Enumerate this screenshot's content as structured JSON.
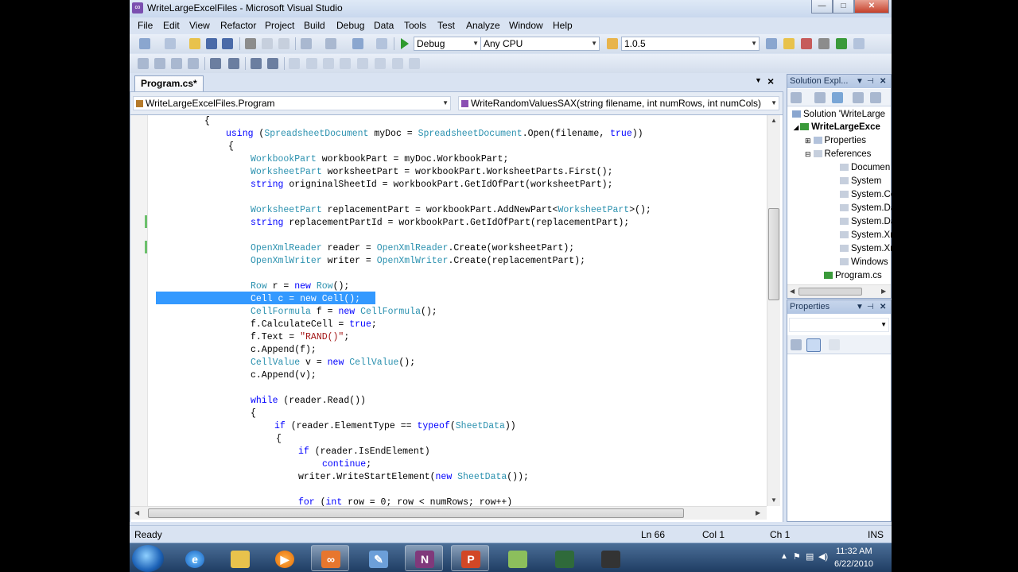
{
  "window": {
    "title": "WriteLargeExcelFiles - Microsoft Visual Studio",
    "min": "0",
    "max": "1",
    "close": "r"
  },
  "menu": [
    "File",
    "Edit",
    "View",
    "Refactor",
    "Project",
    "Build",
    "Debug",
    "Data",
    "Tools",
    "Test",
    "Analyze",
    "Window",
    "Help"
  ],
  "toolbar": {
    "config": "Debug",
    "platform": "Any CPU",
    "version": "1.0.5"
  },
  "tab": {
    "label": "Program.cs*"
  },
  "nav": {
    "class": "WriteLargeExcelFiles.Program",
    "member": "WriteRandomValuesSAX(string filename, int numRows, int numCols)"
  },
  "code": [
    [
      [
        "p",
        "{"
      ]
    ],
    [
      [
        "k",
        "using"
      ],
      [
        "p",
        " ("
      ],
      [
        "t",
        "SpreadsheetDocument"
      ],
      [
        "p",
        " myDoc = "
      ],
      [
        "t",
        "SpreadsheetDocument"
      ],
      [
        "p",
        ".Open(filename, "
      ],
      [
        "k",
        "true"
      ],
      [
        "p",
        "))"
      ]
    ],
    [
      [
        "p",
        "{"
      ]
    ],
    [
      [
        "t",
        "WorkbookPart"
      ],
      [
        "p",
        " workbookPart = myDoc.WorkbookPart;"
      ]
    ],
    [
      [
        "t",
        "WorksheetPart"
      ],
      [
        "p",
        " worksheetPart = workbookPart.WorksheetParts.First();"
      ]
    ],
    [
      [
        "k",
        "string"
      ],
      [
        "p",
        " origninalSheetId = workbookPart.GetIdOfPart(worksheetPart);"
      ]
    ],
    [
      [
        "p",
        ""
      ]
    ],
    [
      [
        "t",
        "WorksheetPart"
      ],
      [
        "p",
        " replacementPart = workbookPart.AddNewPart<"
      ],
      [
        "t",
        "WorksheetPart"
      ],
      [
        "p",
        ">();"
      ]
    ],
    [
      [
        "k",
        "string"
      ],
      [
        "p",
        " replacementPartId = workbookPart.GetIdOfPart(replacementPart);"
      ]
    ],
    [
      [
        "p",
        ""
      ]
    ],
    [
      [
        "t",
        "OpenXmlReader"
      ],
      [
        "p",
        " reader = "
      ],
      [
        "t",
        "OpenXmlReader"
      ],
      [
        "p",
        ".Create(worksheetPart);"
      ]
    ],
    [
      [
        "t",
        "OpenXmlWriter"
      ],
      [
        "p",
        " writer = "
      ],
      [
        "t",
        "OpenXmlWriter"
      ],
      [
        "p",
        ".Create(replacementPart);"
      ]
    ],
    [
      [
        "p",
        ""
      ]
    ],
    [
      [
        "t",
        "Row"
      ],
      [
        "p",
        " r = "
      ],
      [
        "k",
        "new"
      ],
      [
        "p",
        " "
      ],
      [
        "t",
        "Row"
      ],
      [
        "p",
        "();"
      ]
    ],
    [
      [
        "p",
        "Cell c = new Cell();"
      ]
    ],
    [
      [
        "t",
        "CellFormula"
      ],
      [
        "p",
        " f = "
      ],
      [
        "k",
        "new"
      ],
      [
        "p",
        " "
      ],
      [
        "t",
        "CellFormula"
      ],
      [
        "p",
        "();"
      ]
    ],
    [
      [
        "p",
        "f.CalculateCell = "
      ],
      [
        "k",
        "true"
      ],
      [
        "p",
        ";"
      ]
    ],
    [
      [
        "p",
        "f.Text = "
      ],
      [
        "s",
        "\"RAND()\""
      ],
      [
        "p",
        ";"
      ]
    ],
    [
      [
        "p",
        "c.Append(f);"
      ]
    ],
    [
      [
        "t",
        "CellValue"
      ],
      [
        "p",
        " v = "
      ],
      [
        "k",
        "new"
      ],
      [
        "p",
        " "
      ],
      [
        "t",
        "CellValue"
      ],
      [
        "p",
        "();"
      ]
    ],
    [
      [
        "p",
        "c.Append(v);"
      ]
    ],
    [
      [
        "p",
        ""
      ]
    ],
    [
      [
        "k",
        "while"
      ],
      [
        "p",
        " (reader.Read())"
      ]
    ],
    [
      [
        "p",
        "{"
      ]
    ],
    [
      [
        "k",
        "if"
      ],
      [
        "p",
        " (reader.ElementType == "
      ],
      [
        "k",
        "typeof"
      ],
      [
        "p",
        "("
      ],
      [
        "t",
        "SheetData"
      ],
      [
        "p",
        "))"
      ]
    ],
    [
      [
        "p",
        "{"
      ]
    ],
    [
      [
        "k",
        "if"
      ],
      [
        "p",
        " (reader.IsEndElement)"
      ]
    ],
    [
      [
        "k",
        "continue"
      ],
      [
        "p",
        ";"
      ]
    ],
    [
      [
        "p",
        "writer.WriteStartElement("
      ],
      [
        "k",
        "new"
      ],
      [
        "p",
        " "
      ],
      [
        "t",
        "SheetData"
      ],
      [
        "p",
        "());"
      ]
    ],
    [
      [
        "p",
        ""
      ]
    ],
    [
      [
        "k",
        "for"
      ],
      [
        "p",
        " ("
      ],
      [
        "k",
        "int"
      ],
      [
        "p",
        " row = 0; row < numRows; row++)"
      ]
    ]
  ],
  "solution_explorer": {
    "title": "Solution Expl...",
    "items": [
      "Solution 'WriteLarge",
      "WriteLargeExce",
      "Properties",
      "References",
      "Documen",
      "System",
      "System.Co",
      "System.Da",
      "System.Da",
      "System.Xr",
      "System.Xr",
      "Windows",
      "Program.cs"
    ]
  },
  "properties_panel": {
    "title": "Properties"
  },
  "status": {
    "ready": "Ready",
    "ln": "Ln 66",
    "col": "Col 1",
    "ch": "Ch 1",
    "ins": "INS"
  },
  "clock": {
    "time": "11:32 AM",
    "date": "6/22/2010"
  },
  "colors": {
    "keyword": "#0000ff",
    "type": "#2b91af",
    "string": "#a31515",
    "selection": "#3399ff"
  }
}
